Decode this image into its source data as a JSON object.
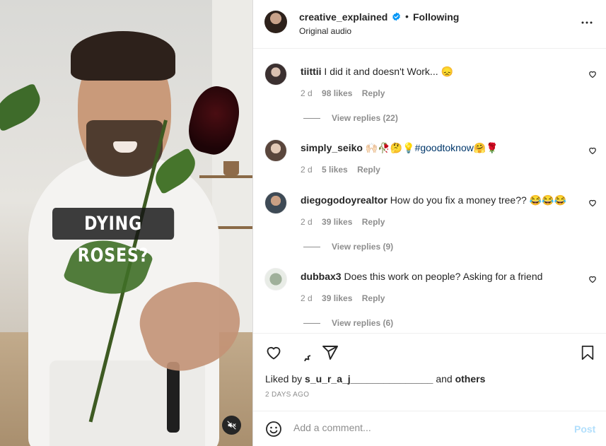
{
  "video": {
    "caption": "DYING ROSES?",
    "mute_icon": "speaker-muted-icon"
  },
  "header": {
    "username": "creative_explained",
    "separator": "•",
    "follow_status": "Following",
    "audio": "Original audio",
    "verified_icon": "verified-badge-icon",
    "more_icon": "more-horizontal-icon"
  },
  "comments": [
    {
      "user": "tiittii",
      "text": " I did it and doesn't Work... 😞",
      "time": "2 d",
      "likes": "98 likes",
      "reply": "Reply",
      "replies": "View replies (22)"
    },
    {
      "user": "simply_seiko",
      "text": " 🙌🏻🥀🤔💡",
      "hashtag": "#goodtoknow",
      "text_after": "🤗🌹",
      "time": "2 d",
      "likes": "5 likes",
      "reply": "Reply",
      "replies": ""
    },
    {
      "user": "diegogodoyrealtor",
      "text": " How do you fix a money tree?? 😂😂😂",
      "time": "2 d",
      "likes": "39 likes",
      "reply": "Reply",
      "replies": "View replies (9)"
    },
    {
      "user": "dubbax3",
      "text": " Does this work on people? Asking for a friend",
      "time": "2 d",
      "likes": "39 likes",
      "reply": "Reply",
      "replies": "View replies (6)"
    }
  ],
  "actions": {
    "liked_prefix": "Liked by ",
    "liked_user": "s_u_r_a_j_______________",
    "liked_mid": " and ",
    "liked_others": "others",
    "date": "2 DAYS AGO"
  },
  "add_comment": {
    "placeholder": "Add a comment...",
    "post_label": "Post"
  },
  "colors": {
    "link": "#00376b",
    "verified": "#0095f6",
    "post_disabled": "#b2dffc",
    "secondary_text": "#8e8e8e"
  }
}
